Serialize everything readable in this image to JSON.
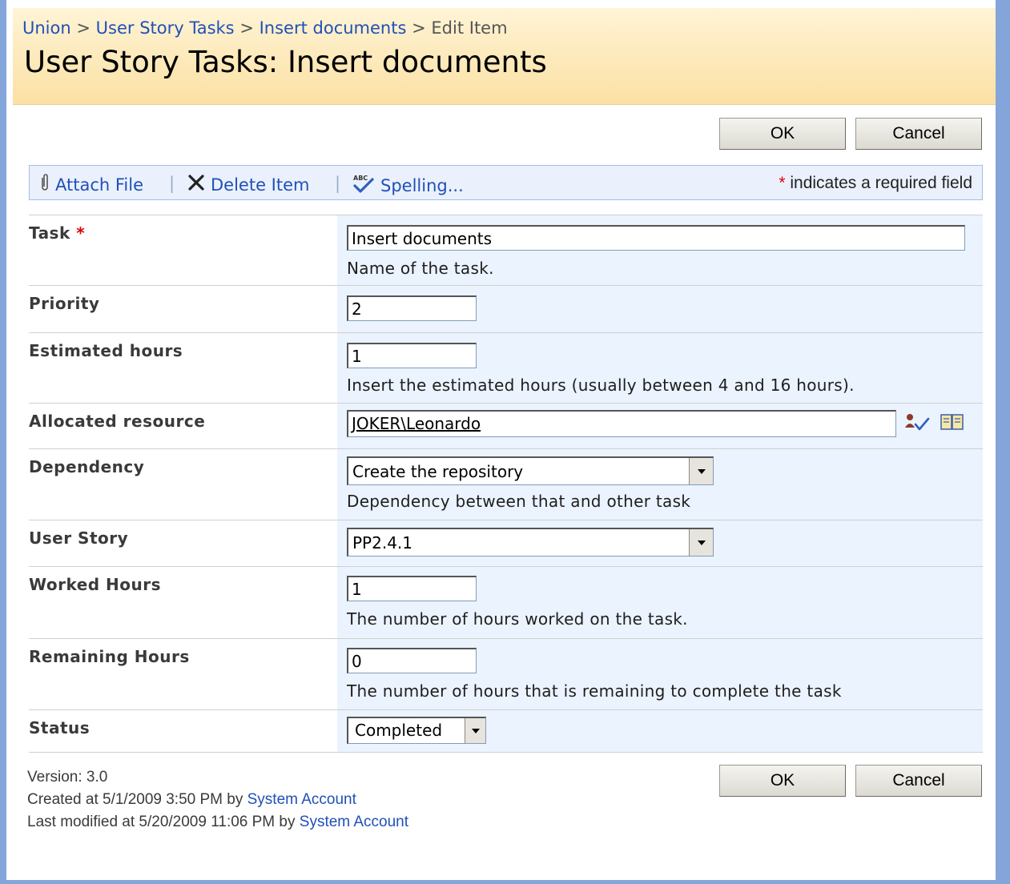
{
  "breadcrumb": {
    "items": [
      "Union",
      "User Story Tasks",
      "Insert documents"
    ],
    "current": "Edit Item",
    "separator": ">"
  },
  "page_title": "User Story Tasks: Insert documents",
  "buttons": {
    "ok": "OK",
    "cancel": "Cancel"
  },
  "toolbar": {
    "attach_file": "Attach File",
    "delete_item": "Delete Item",
    "spelling": "Spelling...",
    "separator": "|",
    "required_star": "*",
    "required_note": "indicates a required field",
    "icons": {
      "attach": "paperclip-icon",
      "delete": "x-icon",
      "spelling": "spellcheck-icon"
    }
  },
  "fields": {
    "task": {
      "label": "Task",
      "required_star": "*",
      "value": "Insert documents",
      "description": "Name of the task."
    },
    "priority": {
      "label": "Priority",
      "value": "2"
    },
    "estimated_hours": {
      "label": "Estimated hours",
      "value": "1",
      "description": "Insert the estimated hours (usually between 4 and 16 hours)."
    },
    "allocated_resource": {
      "label": "Allocated resource",
      "value": "JOKER\\Leonardo",
      "icons": [
        "check-names-icon",
        "address-book-icon"
      ]
    },
    "dependency": {
      "label": "Dependency",
      "value": "Create the repository",
      "description": "Dependency between that and other task"
    },
    "user_story": {
      "label": "User Story",
      "value": "PP2.4.1"
    },
    "worked_hours": {
      "label": "Worked Hours",
      "value": "1",
      "description": "The number of hours worked on the task."
    },
    "remaining_hours": {
      "label": "Remaining Hours",
      "value": "0",
      "description": "The number of hours that is remaining to complete the task"
    },
    "status": {
      "label": "Status",
      "value": "Completed"
    }
  },
  "footer": {
    "version": "Version: 3.0",
    "created_prefix": "Created at 5/1/2009 3:50 PM  by",
    "created_by": "System Account",
    "modified_prefix": "Last modified at 5/20/2009 11:06 PM  by",
    "modified_by": "System Account"
  },
  "colors": {
    "title_band": "#fbe0a3",
    "link": "#2050b8",
    "value_cell": "#ebf3ff",
    "frame": "#83a5d9",
    "required": "#dd0000"
  }
}
